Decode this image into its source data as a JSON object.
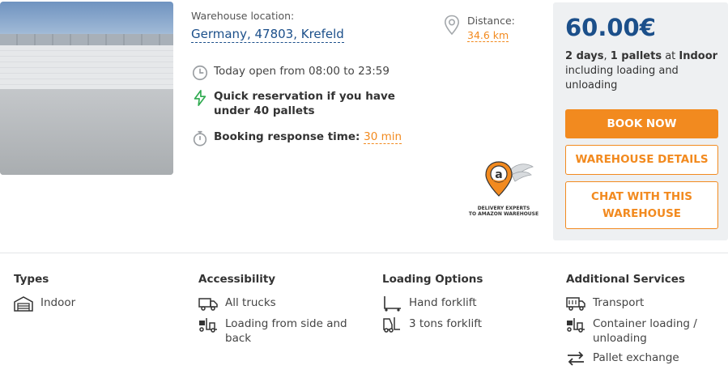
{
  "listing": {
    "location_label": "Warehouse location:",
    "location_value": "Germany, 47803, Krefeld",
    "opening_hours": "Today open from 08:00 to 23:59",
    "quick_reservation": "Quick reservation if you have under 40 pallets",
    "response_label": "Booking response time:",
    "response_value": "30 min",
    "distance_label": "Distance:",
    "distance_value": "34.6 km",
    "badge_caption_1": "DELIVERY EXPERTS",
    "badge_caption_2": "TO AMAZON WAREHOUSE",
    "badge_letter": "a"
  },
  "pricing": {
    "price": "60.00€",
    "days": "2 days",
    "sep": ", ",
    "pallets": "1 pallets",
    "at": " at ",
    "type": "Indoor",
    "rest": " including loading and unloading",
    "book_label": "BOOK NOW",
    "details_label": "WAREHOUSE DETAILS",
    "chat_label": "CHAT WITH THIS WAREHOUSE"
  },
  "features": {
    "types": {
      "title": "Types",
      "items": [
        "Indoor"
      ]
    },
    "accessibility": {
      "title": "Accessibility",
      "items": [
        "All trucks",
        "Loading from side and back"
      ]
    },
    "loading": {
      "title": "Loading Options",
      "items": [
        "Hand forklift",
        "3 tons forklift"
      ]
    },
    "services": {
      "title": "Additional Services",
      "items": [
        "Transport",
        "Container loading / unloading",
        "Pallet exchange"
      ]
    }
  },
  "colors": {
    "accent": "#f28a1f",
    "brand": "#1b4f8a",
    "quick_icon": "#2eaa4f",
    "panel": "#eef0f2"
  },
  "icons": [
    "clock-icon",
    "lightning-icon",
    "stopwatch-icon",
    "map-pin-icon",
    "warehouse-icon",
    "truck-icon",
    "forklift-icon",
    "hand-pallet-icon",
    "transport-truck-icon",
    "arrows-exchange-icon"
  ]
}
